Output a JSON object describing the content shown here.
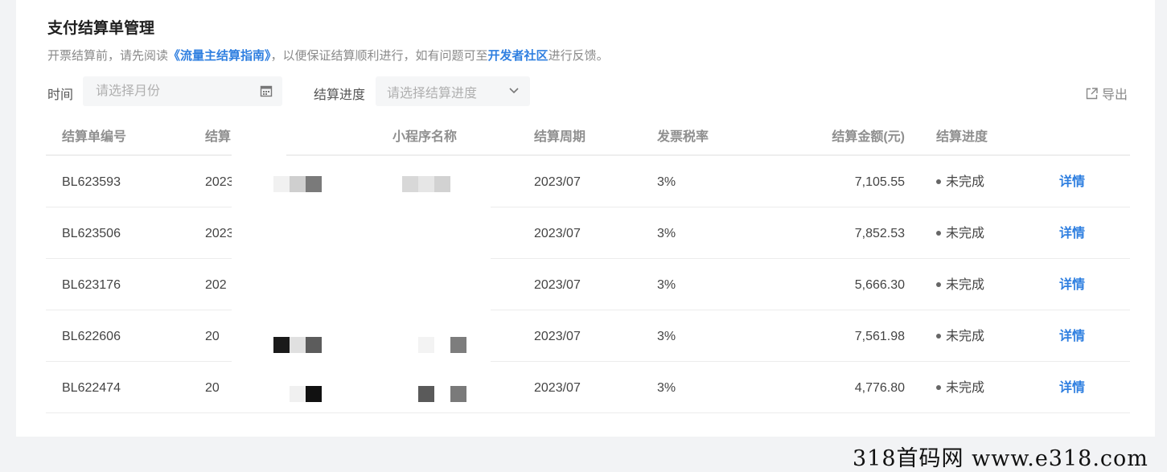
{
  "page": {
    "title": "支付结算单管理",
    "notice": {
      "prefix": "开票结算前，请先阅读",
      "guide_link": "《流量主结算指南》",
      "middle": "，以便保证结算顺利进行，如有问题可至",
      "community_link": "开发者社区",
      "suffix": "进行反馈。"
    }
  },
  "filters": {
    "time_label": "时间",
    "time_placeholder": "请选择月份",
    "time_icon": "calendar-icon",
    "progress_label": "结算进度",
    "progress_placeholder": "请选择结算进度",
    "progress_icon": "chevron-down-icon"
  },
  "export": {
    "label": "导出",
    "icon": "export-icon"
  },
  "table": {
    "headers": [
      "结算单编号",
      "结算",
      "小程序名称",
      "结算周期",
      "发票税率",
      "结算金额(元)",
      "结算进度",
      ""
    ],
    "rows": [
      {
        "id": "BL623593",
        "date": "2023",
        "app": "",
        "period": "2023/07",
        "tax": "3%",
        "amount": "7,105.55",
        "status": "未完成",
        "action": "详情"
      },
      {
        "id": "BL623506",
        "date": "2023",
        "app": "",
        "period": "2023/07",
        "tax": "3%",
        "amount": "7,852.53",
        "status": "未完成",
        "action": "详情"
      },
      {
        "id": "BL623176",
        "date": "202",
        "app": "",
        "period": "2023/07",
        "tax": "3%",
        "amount": "5,666.30",
        "status": "未完成",
        "action": "详情"
      },
      {
        "id": "BL622606",
        "date": "20",
        "app": "",
        "period": "2023/07",
        "tax": "3%",
        "amount": "7,561.98",
        "status": "未完成",
        "action": "详情"
      },
      {
        "id": "BL622474",
        "date": "20",
        "app": "",
        "period": "2023/07",
        "tax": "3%",
        "amount": "4,776.80",
        "status": "未完成",
        "action": "详情"
      }
    ]
  },
  "watermark": "318首码网  www.e318.com",
  "colors": {
    "accent": "#2f7fe0",
    "background": "#f2f3f5"
  }
}
